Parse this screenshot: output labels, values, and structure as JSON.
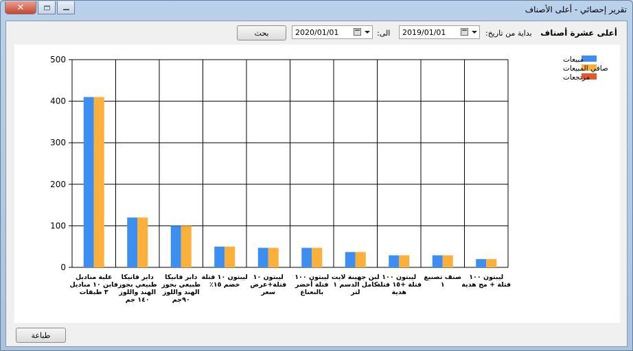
{
  "window": {
    "title": "تقرير إحصائي - أعلى الأصناف",
    "close_icon": "close-icon",
    "maximize_icon": "maximize-icon",
    "minimize_icon": "minimize-icon"
  },
  "header": {
    "title": "أعلى عشرة أصناف",
    "from_label": "بداية من تاريخ:",
    "from_value": "2019/01/01",
    "to_label": "الى:",
    "to_value": "2020/01/01",
    "search_label": "بحث"
  },
  "footer": {
    "print_label": "طباعة"
  },
  "colors": {
    "sales": "#3e8ef0",
    "net_sales": "#fbb03b",
    "returns": "#e2572f"
  },
  "chart_data": {
    "type": "bar",
    "ylim": [
      0,
      500
    ],
    "yticks": [
      0,
      100,
      200,
      300,
      400,
      500
    ],
    "grid": true,
    "legend_position": "top-right",
    "categories": [
      [
        "علبة مناديل",
        "فاين ١٠ مناديل",
        "٣ طبقات"
      ],
      [
        "دابر فانيكا",
        "طبيعي بجوز",
        "الهند واللوز",
        "١٤٠ جم"
      ],
      [
        "دابر فانيكا",
        "طبيعي بجوز",
        "الهند واللوز",
        "٩٠جم"
      ],
      [
        "ليبتون ١٠ فتلة",
        "خصم ١٥٪"
      ],
      [
        "ليبتون ١٠",
        "فتلة+عرض",
        "سعر"
      ],
      [
        "ليبتون ١٠٠",
        "فتلة أخضر",
        "بالنعناع"
      ],
      [
        "لبن جهينة لايت",
        "كامل الدسم ١",
        "لتر"
      ],
      [
        "ليبتون ١٠٠",
        "فتلة +١٥ فتلة",
        "هدية"
      ],
      [
        "صنف تصنيع",
        "١"
      ],
      [
        "ليبتون ١٠٠",
        "فتلة + مج هدية"
      ]
    ],
    "series": [
      {
        "name": "مبيعات",
        "values": [
          410,
          120,
          100,
          50,
          47,
          47,
          37,
          29,
          29,
          20
        ]
      },
      {
        "name": "صافي المبيعات",
        "values": [
          410,
          120,
          100,
          50,
          47,
          47,
          37,
          29,
          29,
          20
        ]
      },
      {
        "name": "مرتجعات",
        "values": [
          0,
          0,
          0,
          0,
          0,
          0,
          0,
          0,
          0,
          0
        ]
      }
    ]
  }
}
